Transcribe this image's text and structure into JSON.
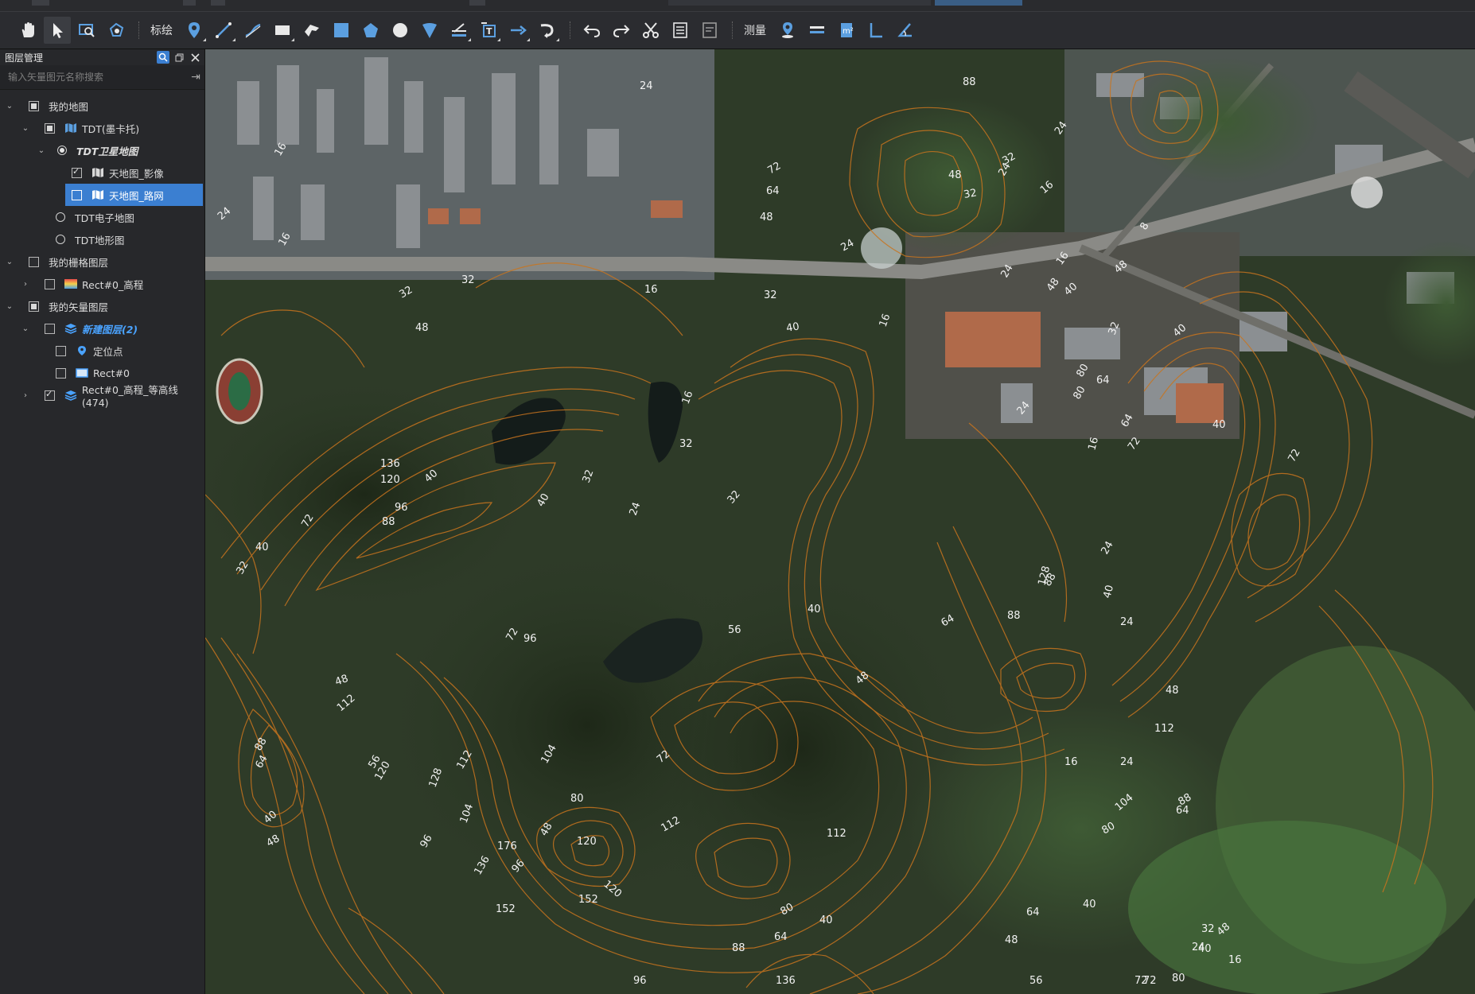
{
  "toolbar": {
    "biaohui_label": "标绘",
    "celiang_label": "测量"
  },
  "layer_panel": {
    "title": "图层管理",
    "search_placeholder": "输入矢量图元名称搜索",
    "items": [
      {
        "label": "我的地图"
      },
      {
        "label": "TDT(墨卡托)"
      },
      {
        "label": "TDT卫星地图"
      },
      {
        "label": "天地图_影像"
      },
      {
        "label": "天地图_路网"
      },
      {
        "label": "TDT电子地图"
      },
      {
        "label": "TDT地形图"
      },
      {
        "label": "我的栅格图层"
      },
      {
        "label": "Rect#0_高程"
      },
      {
        "label": "我的矢量图层"
      },
      {
        "label": "新建图层(2)"
      },
      {
        "label": "定位点"
      },
      {
        "label": "Rect#0"
      },
      {
        "label": "Rect#0_高程_等高线(474)"
      }
    ]
  },
  "map": {
    "contour_color": "#c8741e",
    "contour_labels": [
      "24",
      "16",
      "88",
      "24",
      "32",
      "48",
      "32",
      "8",
      "24",
      "16",
      "72",
      "64",
      "48",
      "16",
      "32",
      "24",
      "16",
      "24",
      "48",
      "40",
      "32",
      "32",
      "40",
      "48",
      "40",
      "24",
      "16",
      "16",
      "32",
      "64",
      "16",
      "80",
      "72",
      "48",
      "136",
      "120",
      "96",
      "88",
      "72",
      "40",
      "32",
      "40",
      "40",
      "40",
      "32",
      "32",
      "24",
      "16",
      "24",
      "64",
      "80",
      "32",
      "24",
      "72",
      "40",
      "128",
      "88",
      "88",
      "64",
      "24",
      "40",
      "56",
      "48",
      "48",
      "96",
      "72",
      "48",
      "112",
      "88",
      "64",
      "40",
      "48",
      "56",
      "120",
      "112",
      "128",
      "104",
      "96",
      "176",
      "136",
      "96",
      "152",
      "152",
      "120",
      "80",
      "112",
      "104",
      "48",
      "72",
      "112",
      "64",
      "88",
      "136",
      "120",
      "96",
      "40",
      "80",
      "112",
      "104",
      "80",
      "72",
      "56",
      "48",
      "64",
      "40",
      "88",
      "64",
      "72",
      "80",
      "40",
      "48",
      "32",
      "16",
      "24",
      "16",
      "24"
    ]
  }
}
